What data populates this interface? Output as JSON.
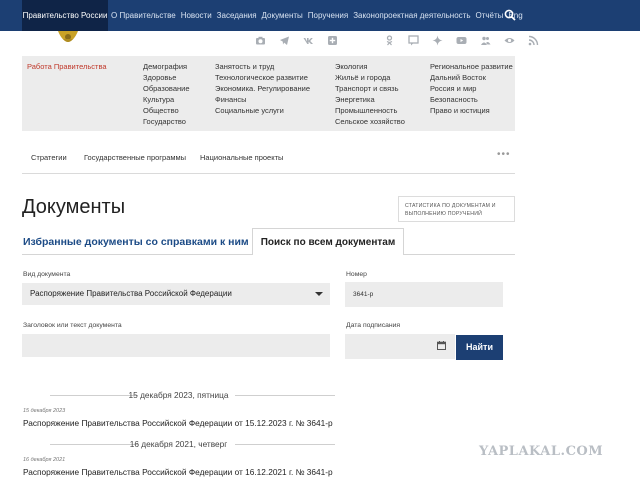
{
  "header": {
    "brand": "Правительство России",
    "nav": [
      "О Правительстве",
      "Новости",
      "Заседания",
      "Документы",
      "Поручения",
      "Законопроектная деятельность",
      "Отчёты",
      "Eng"
    ]
  },
  "social_icons": [
    "camera-icon",
    "telegram-icon",
    "vk-icon",
    "plus-icon",
    "ok-icon",
    "comment-icon",
    "dzen-icon",
    "youtube-icon",
    "community-icon",
    "eye-icon",
    "rss-icon"
  ],
  "categories": {
    "home_link": "Работа Правительства",
    "col1": [
      "Демография",
      "Здоровье",
      "Образование",
      "Культура",
      "Общество",
      "Государство"
    ],
    "col2": [
      "Занятость и труд",
      "Технологическое развитие",
      "Экономика. Регулирование",
      "Финансы",
      "Социальные услуги"
    ],
    "col3": [
      "Экология",
      "Жильё и города",
      "Транспорт и связь",
      "Энергетика",
      "Промышленность",
      "Сельское хозяйство"
    ],
    "col4": [
      "Региональное развитие",
      "Дальний Восток",
      "Россия и мир",
      "Безопасность",
      "Право и юстиция"
    ]
  },
  "subnav": {
    "items": [
      "Стратегии",
      "Государственные программы",
      "Национальные проекты"
    ],
    "more": "•••"
  },
  "page": {
    "title": "Документы",
    "stats_box": "СТАТИСТИКА ПО ДОКУМЕНТАМ И ВЫПОЛНЕНИЮ ПОРУЧЕНИЙ"
  },
  "tabs": {
    "favorites": "Избранные документы со справками к ним",
    "search_all": "Поиск по всем документам"
  },
  "form": {
    "doc_type_label": "Вид документа",
    "doc_type_value": "Распоряжение Правительства Российской Федерации",
    "number_label": "Номер",
    "number_value": "3641-р",
    "title_label": "Заголовок или текст документа",
    "title_value": "",
    "date_label": "Дата подписания",
    "date_value": "",
    "find_button": "Найти"
  },
  "results": [
    {
      "separator": "15 декабря 2023, пятница",
      "date": "15 декабря 2023",
      "title": "Распоряжение Правительства Российской Федерации от 15.12.2023 г. № 3641-р"
    },
    {
      "separator": "16 декабря 2021, четверг",
      "date": "16 декабря 2021",
      "title": "Распоряжение Правительства Российской Федерации от 16.12.2021 г. № 3641-р"
    }
  ],
  "watermark": "YAPLAKAL.COM",
  "colors": {
    "nav_bg": "#1c3f73",
    "brand_bg": "#0f2447",
    "accent_red": "#c0392b",
    "panel_bg": "#ececec",
    "link_blue": "#1c4b86"
  }
}
